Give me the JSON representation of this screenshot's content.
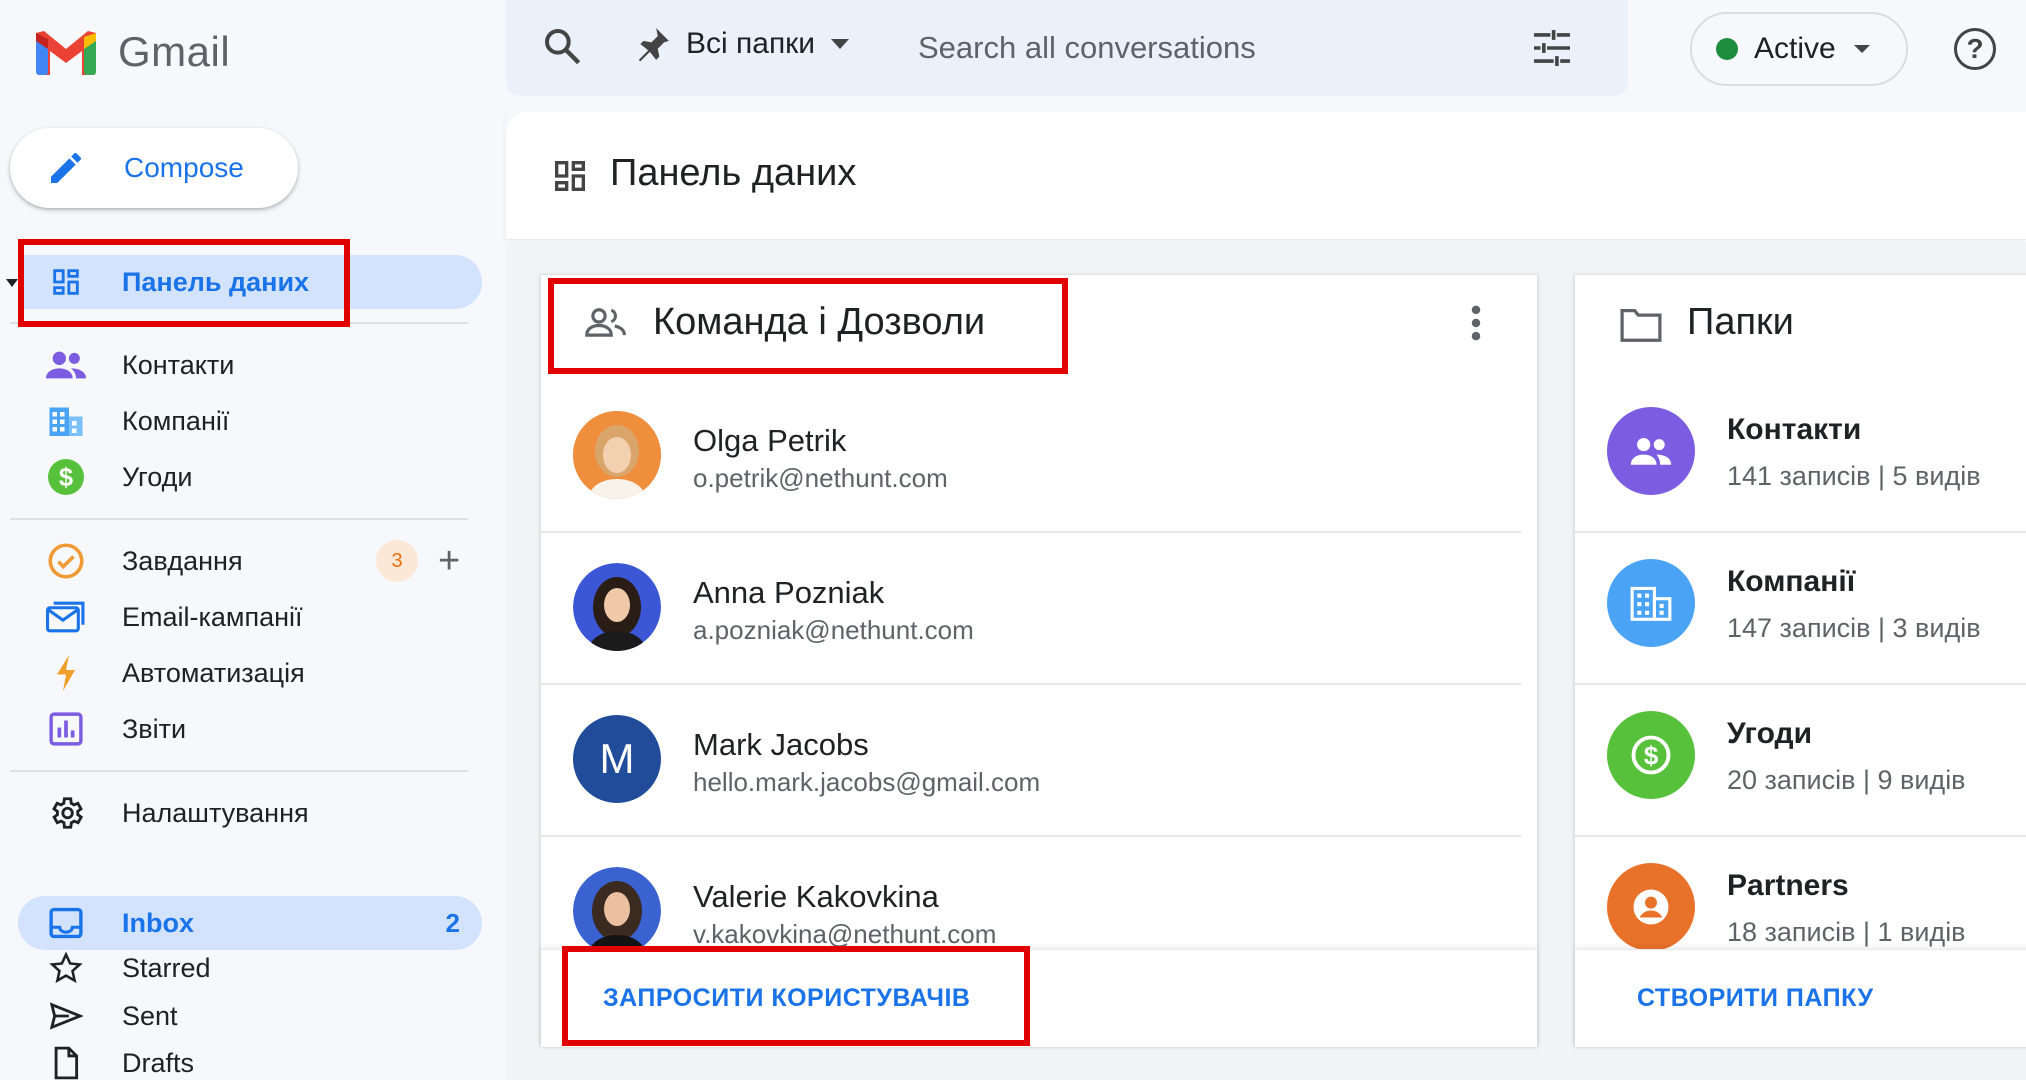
{
  "app": {
    "name": "Gmail"
  },
  "sidebar": {
    "compose_label": "Compose",
    "items": [
      {
        "label": "Панель даних",
        "icon": "dashboard-icon"
      },
      {
        "label": "Контакти",
        "icon": "contacts-icon"
      },
      {
        "label": "Компанії",
        "icon": "companies-icon"
      },
      {
        "label": "Угоди",
        "icon": "deals-icon"
      },
      {
        "label": "Завдання",
        "icon": "tasks-icon",
        "badge": "3"
      },
      {
        "label": "Email-кампанії",
        "icon": "email-campaigns-icon"
      },
      {
        "label": "Автоматизація",
        "icon": "automation-icon"
      },
      {
        "label": "Звіти",
        "icon": "reports-icon"
      },
      {
        "label": "Налаштування",
        "icon": "settings-icon"
      },
      {
        "label": "Inbox",
        "icon": "inbox-icon",
        "count": "2"
      },
      {
        "label": "Starred",
        "icon": "star-icon"
      },
      {
        "label": "Sent",
        "icon": "send-icon"
      },
      {
        "label": "Drafts",
        "icon": "draft-icon"
      }
    ]
  },
  "search": {
    "folder_label": "Всі папки",
    "placeholder": "Search all conversations"
  },
  "status": {
    "label": "Active",
    "color": "#1e8e3e"
  },
  "page": {
    "title": "Панель даних"
  },
  "team_card": {
    "title": "Команда і Дозволи",
    "members": [
      {
        "name": "Olga Petrik",
        "email": "o.petrik@nethunt.com"
      },
      {
        "name": "Anna Pozniak",
        "email": "a.pozniak@nethunt.com"
      },
      {
        "name": "Mark Jacobs",
        "email": "hello.mark.jacobs@gmail.com",
        "initial": "M"
      },
      {
        "name": "Valerie Kakovkina",
        "email": "v.kakovkina@nethunt.com"
      }
    ],
    "action_label": "ЗАПРОСИТИ КОРИСТУВАЧІВ"
  },
  "folders_card": {
    "title": "Папки",
    "folders": [
      {
        "name": "Контакти",
        "meta": "141 записів | 5 видів",
        "color": "#7c5ce0"
      },
      {
        "name": "Компанії",
        "meta": "147 записів | 3 видів",
        "color": "#4ba3f5"
      },
      {
        "name": "Угоди",
        "meta": "20 записів | 9 видів",
        "color": "#58c13c"
      },
      {
        "name": "Partners",
        "meta": "18 записів | 1 видів",
        "color": "#e8722a"
      }
    ],
    "action_label": "СТВОРИТИ ПАПКУ"
  },
  "colors": {
    "accent": "#1a73e8",
    "highlight": "#e00000"
  }
}
